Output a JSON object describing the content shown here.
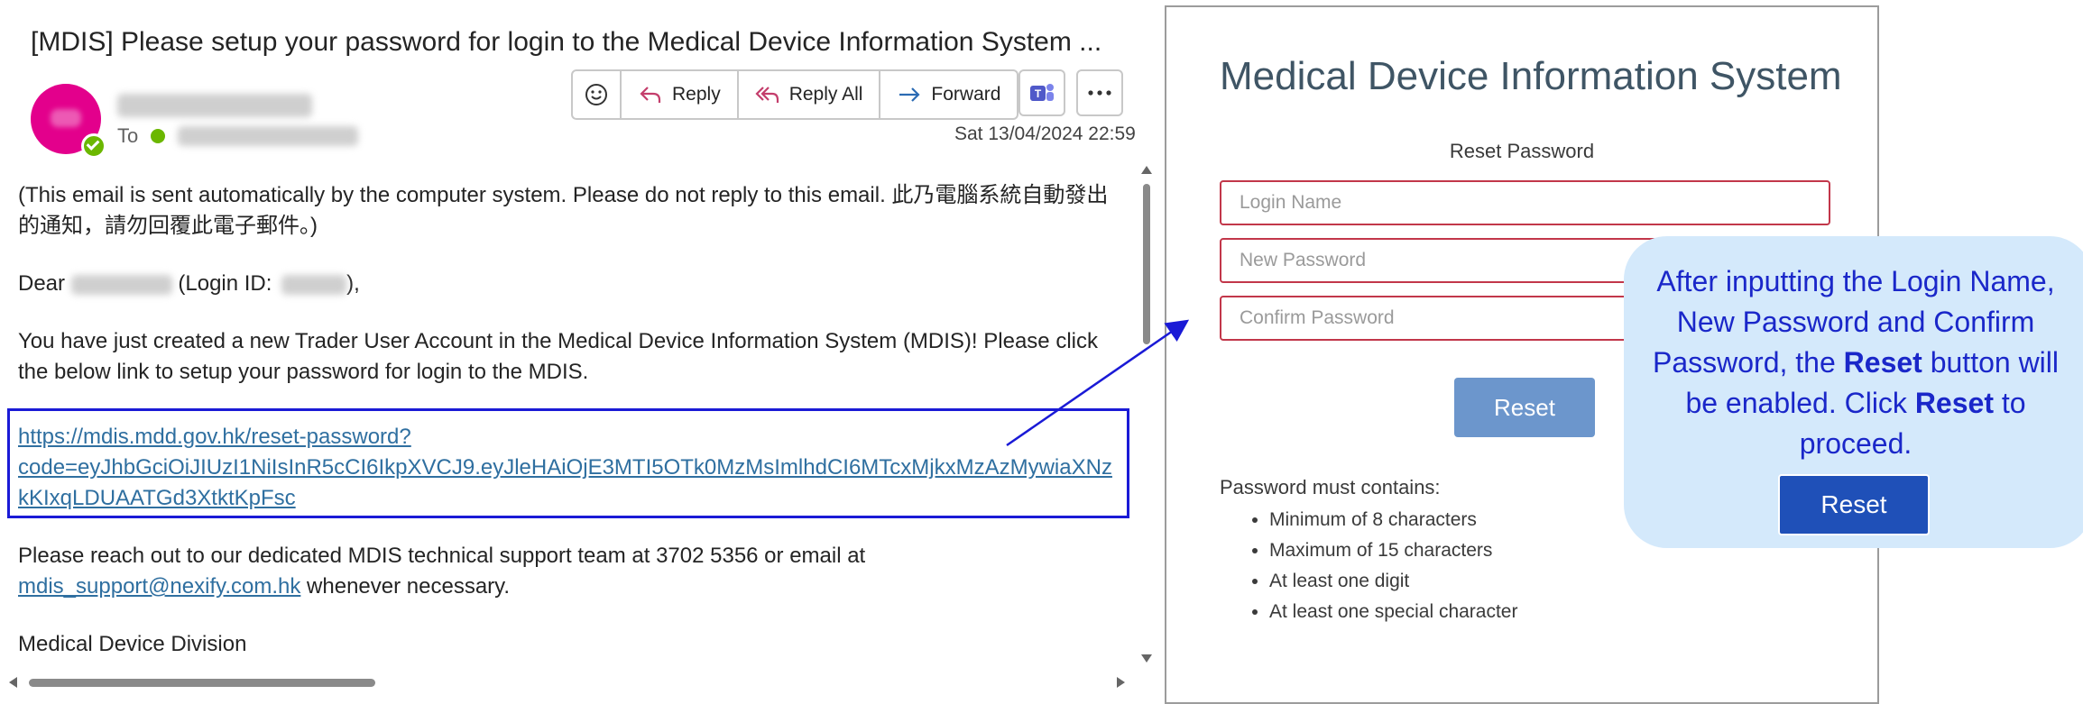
{
  "email": {
    "subject": "[MDIS] Please setup your password for login to the Medical Device Information System ...",
    "to_label": "To",
    "toolbar": {
      "emoji_icon": "smiley-icon",
      "reply": "Reply",
      "reply_all": "Reply All",
      "forward": "Forward",
      "teams_icon": "teams-icon",
      "more_icon": "more-icon"
    },
    "date": "Sat 13/04/2024 22:59",
    "body": {
      "p1": "(This email is sent automatically by the computer system. Please do not reply to this email. 此乃電腦系統自動發出的通知，請勿回覆此電子郵件。)",
      "dear": "Dear",
      "login_id_prefix": "(Login ID:",
      "login_id_suffix": "),",
      "p2": "You have just created a new Trader User Account in the Medical Device Information System (MDIS)! Please click the below link to setup your password for login to the MDIS.",
      "link_line1": "https://mdis.mdd.gov.hk/reset-password?",
      "link_line2": "code=eyJhbGciOiJIUzI1NiIsInR5cCI6IkpXVCJ9.eyJleHAiOjE3MTI5OTk0MzMsImlhdCI6MTcxMjkxMzAzMywiaXNz",
      "link_line3": "kKIxqLDUAATGd3XtktKpFsc",
      "p3_a": "Please reach out to our dedicated MDIS technical support team at 3702 5356 or email at",
      "support_email": "mdis_support@nexify.com.hk",
      "p3_b": " whenever necessary.",
      "sign": "Medical Device Division"
    }
  },
  "panel": {
    "title": "Medical Device Information System",
    "subtitle": "Reset Password",
    "fields": {
      "login_name": "Login Name",
      "new_password": "New Password",
      "confirm_password": "Confirm Password"
    },
    "reset_button": "Reset",
    "rules_title": "Password must contains:",
    "rules": [
      "Minimum of 8 characters",
      "Maximum of 15 characters",
      "At least one digit",
      "At least one special character"
    ]
  },
  "callout": {
    "t1": "After inputting the Login Name, New Password and Confirm Password, the ",
    "b1": "Reset",
    "t2": " button will be enabled. Click ",
    "b2": "Reset",
    "t3": " to proceed.",
    "button": "Reset"
  },
  "colors": {
    "avatar": "#e3008c",
    "presence": "#6bb700",
    "highlight_box": "#1a1ad6",
    "field_border": "#c2374a",
    "reset_disabled": "#6c96cc",
    "callout_bg": "#d4e9fb",
    "callout_text": "#1a27c9",
    "callout_button": "#1f50b8"
  }
}
